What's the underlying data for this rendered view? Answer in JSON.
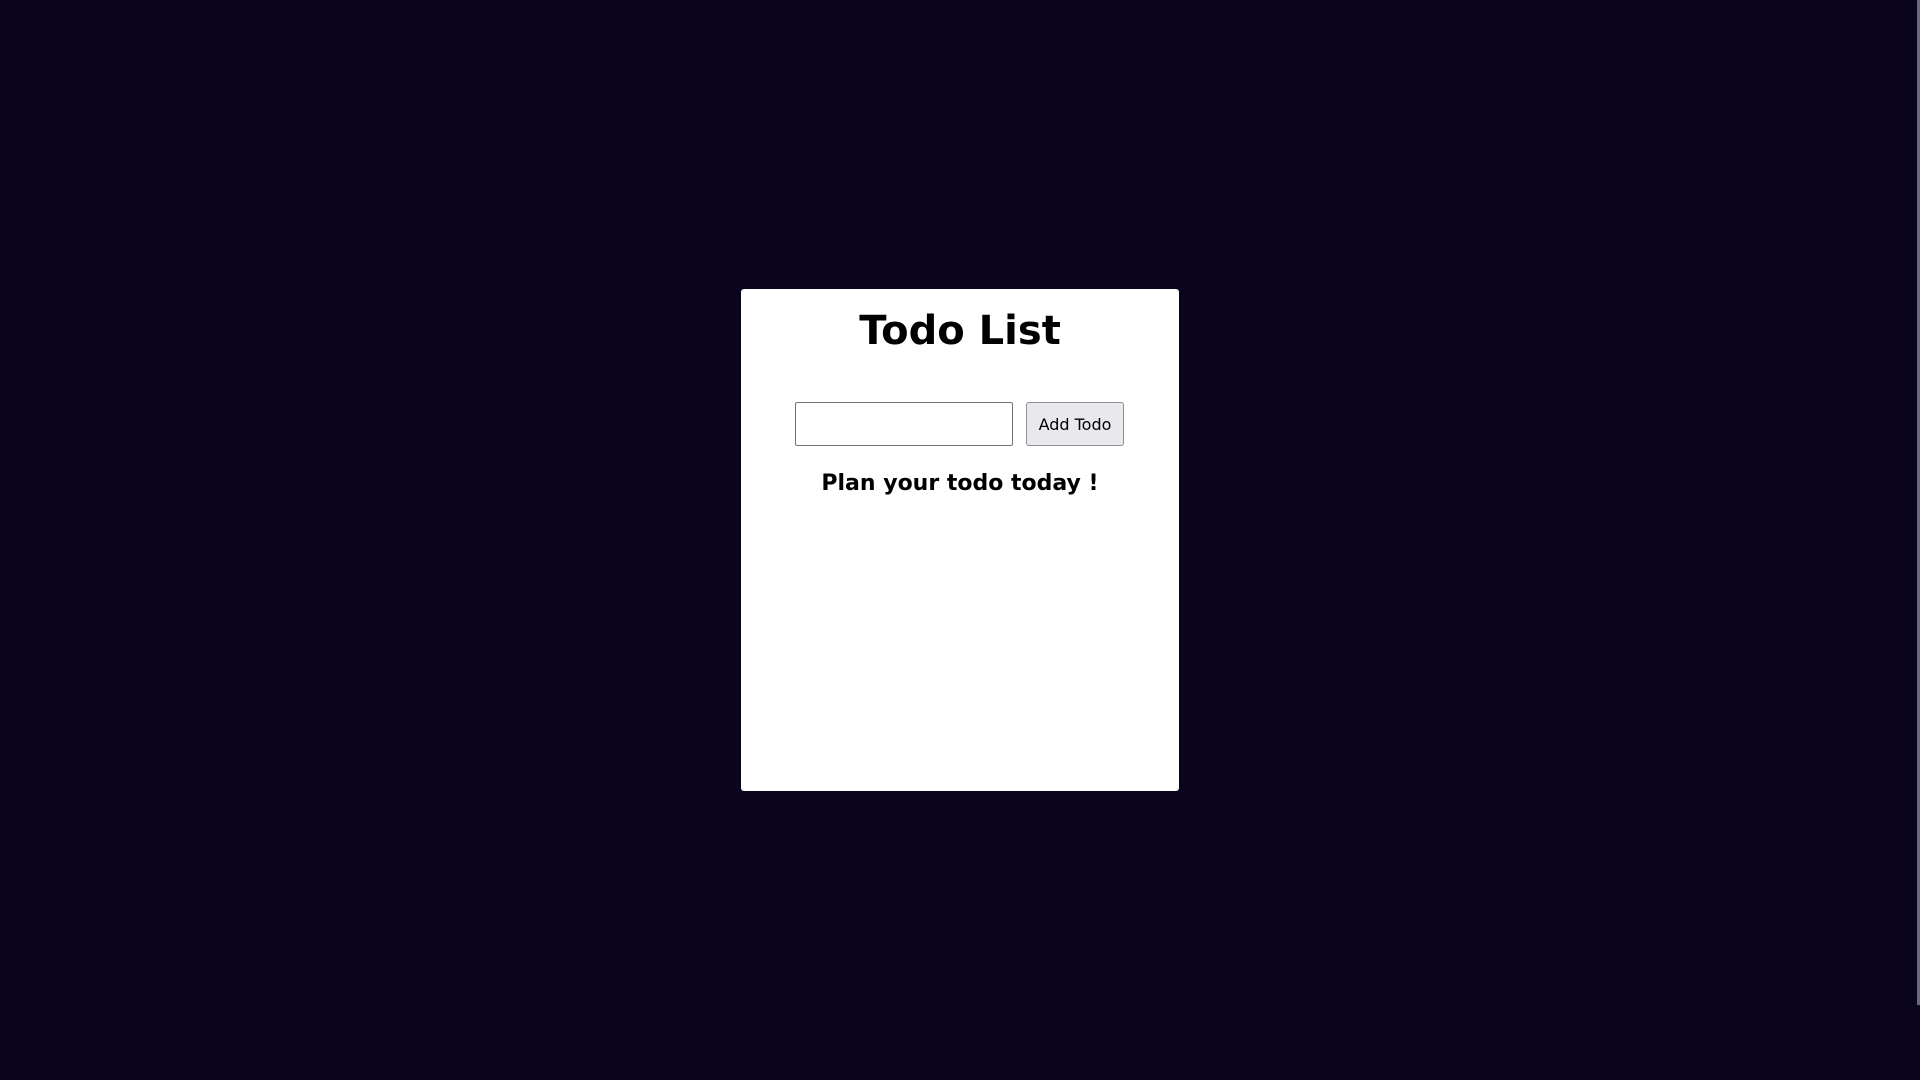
{
  "app": {
    "title": "Todo List"
  },
  "form": {
    "input_value": "",
    "input_placeholder": "",
    "add_button_label": "Add Todo"
  },
  "list": {
    "empty_message": "Plan your todo today !",
    "items": []
  },
  "colors": {
    "background": "#0a041d",
    "card": "#ffffff",
    "button_bg": "#e9e9ed"
  }
}
